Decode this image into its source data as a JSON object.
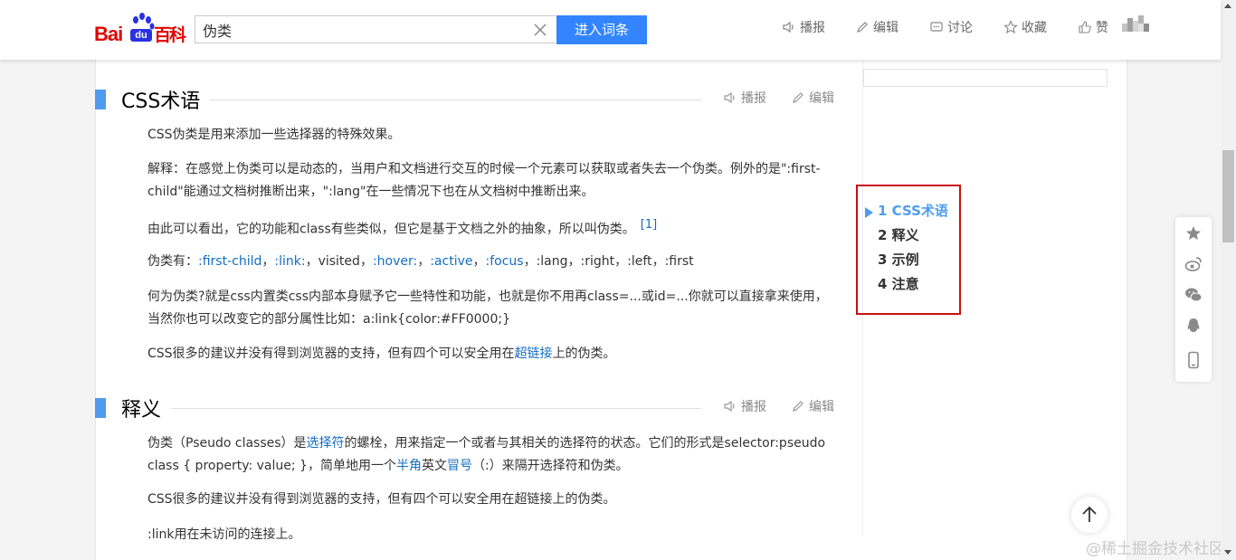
{
  "header": {
    "logo_text_bai": "Bai",
    "logo_text_du": "du",
    "logo_text_baike": "百科",
    "search_value": "伪类",
    "search_button": "进入词条",
    "tools": [
      "播报",
      "编辑",
      "讨论",
      "收藏",
      "赞"
    ]
  },
  "sections": [
    {
      "title": "CSS术语",
      "actions": [
        "播报",
        "编辑"
      ]
    },
    {
      "title": "释义",
      "actions": [
        "播报",
        "编辑"
      ]
    }
  ],
  "section1": {
    "p1": "CSS伪类是用来添加一些选择器的特殊效果。",
    "p2": "解释：在感觉上伪类可以是动态的，当用户和文档进行交互的时候一个元素可以获取或者失去一个伪类。例外的是\":first-child\"能通过文档树推断出来，\":lang\"在一些情况下也在从文档树中推断出来。",
    "p3": "由此可以看出，它的功能和class有些类似，但它是基于文档之外的抽象，所以叫伪类。",
    "p3_ref": "[1]",
    "p4_prefix": "伪类有：",
    "p4_links": [
      ":first-child",
      ":link:",
      ":hover:",
      ":active",
      ":focus"
    ],
    "p4_plain": [
      "visited",
      ":lang",
      ":right",
      ":left",
      ":first"
    ],
    "p5": "何为伪类?就是css内置类css内部本身赋予它一些特性和功能，也就是你不用再class=...或id=...你就可以直接拿来使用，当然你也可以改变它的部分属性比如：a:link{color:#FF0000;}",
    "p6_before": "CSS很多的建议并没有得到浏览器的支持，但有四个可以安全用在",
    "p6_link": "超链接",
    "p6_after": "上的伪类。"
  },
  "section2": {
    "p1_a": "伪类（Pseudo classes）是",
    "p1_link1": "选择符",
    "p1_b": "的螺栓，用来指定一个或者与其相关的选择符的状态。它们的形式是selector:pseudo class { property: value; }，简单地用一个",
    "p1_link2": "半角",
    "p1_c": "英文",
    "p1_link3": "冒号",
    "p1_d": "（:）来隔开选择符和伪类。",
    "p2": "CSS很多的建议并没有得到浏览器的支持，但有四个可以安全用在超链接上的伪类。",
    "p3": ":link用在未访问的连接上。"
  },
  "catalog": {
    "items": [
      {
        "num": "1",
        "label": "CSS术语"
      },
      {
        "num": "2",
        "label": "释义"
      },
      {
        "num": "3",
        "label": "示例"
      },
      {
        "num": "4",
        "label": "注意"
      }
    ],
    "active_index": 0
  },
  "watermark": "@稀土掘金技术社区",
  "colors": {
    "accent": "#4f9cee",
    "link": "#136ec2",
    "search_button": "#3385ff",
    "brand_red": "#e10601",
    "highlight_box": "#c81010"
  }
}
